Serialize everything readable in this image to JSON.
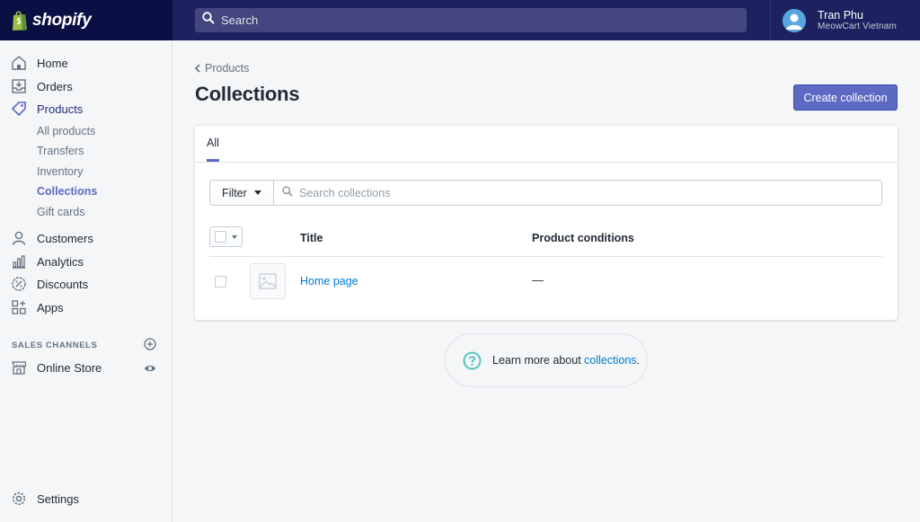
{
  "brand": {
    "name": "shopify",
    "icon": "shopify-bag-icon"
  },
  "topbar": {
    "search_placeholder": "Search",
    "search_icon": "search-icon"
  },
  "user": {
    "name": "Tran Phu",
    "shop": "MeowCart Vietnam"
  },
  "sidebar": {
    "items": [
      {
        "label": "Home",
        "icon": "home-icon"
      },
      {
        "label": "Orders",
        "icon": "orders-icon"
      },
      {
        "label": "Products",
        "icon": "tag-icon"
      },
      {
        "label": "Customers",
        "icon": "person-icon"
      },
      {
        "label": "Analytics",
        "icon": "bar-chart-icon"
      },
      {
        "label": "Discounts",
        "icon": "discount-icon"
      },
      {
        "label": "Apps",
        "icon": "apps-icon"
      }
    ],
    "product_subitems": [
      "All products",
      "Transfers",
      "Inventory",
      "Collections",
      "Gift cards"
    ],
    "active_subitem": "Collections",
    "sales_channels_title": "SALES CHANNELS",
    "online_store": "Online Store",
    "settings": "Settings"
  },
  "page": {
    "breadcrumb": "Products",
    "title": "Collections",
    "create_button": "Create collection"
  },
  "card": {
    "tabs": [
      "All"
    ],
    "filter_label": "Filter",
    "search_placeholder": "Search collections",
    "columns": {
      "title": "Title",
      "conditions": "Product conditions"
    },
    "rows": [
      {
        "title": "Home page",
        "conditions": "—"
      }
    ]
  },
  "learn_more": {
    "prefix": "Learn more about ",
    "link": "collections",
    "suffix": "."
  },
  "colors": {
    "topbar": "#1c2260",
    "brand_bg": "#0b1044",
    "primary": "#5c6ac4",
    "link": "#007ace",
    "help_icon": "#47c1bf"
  }
}
